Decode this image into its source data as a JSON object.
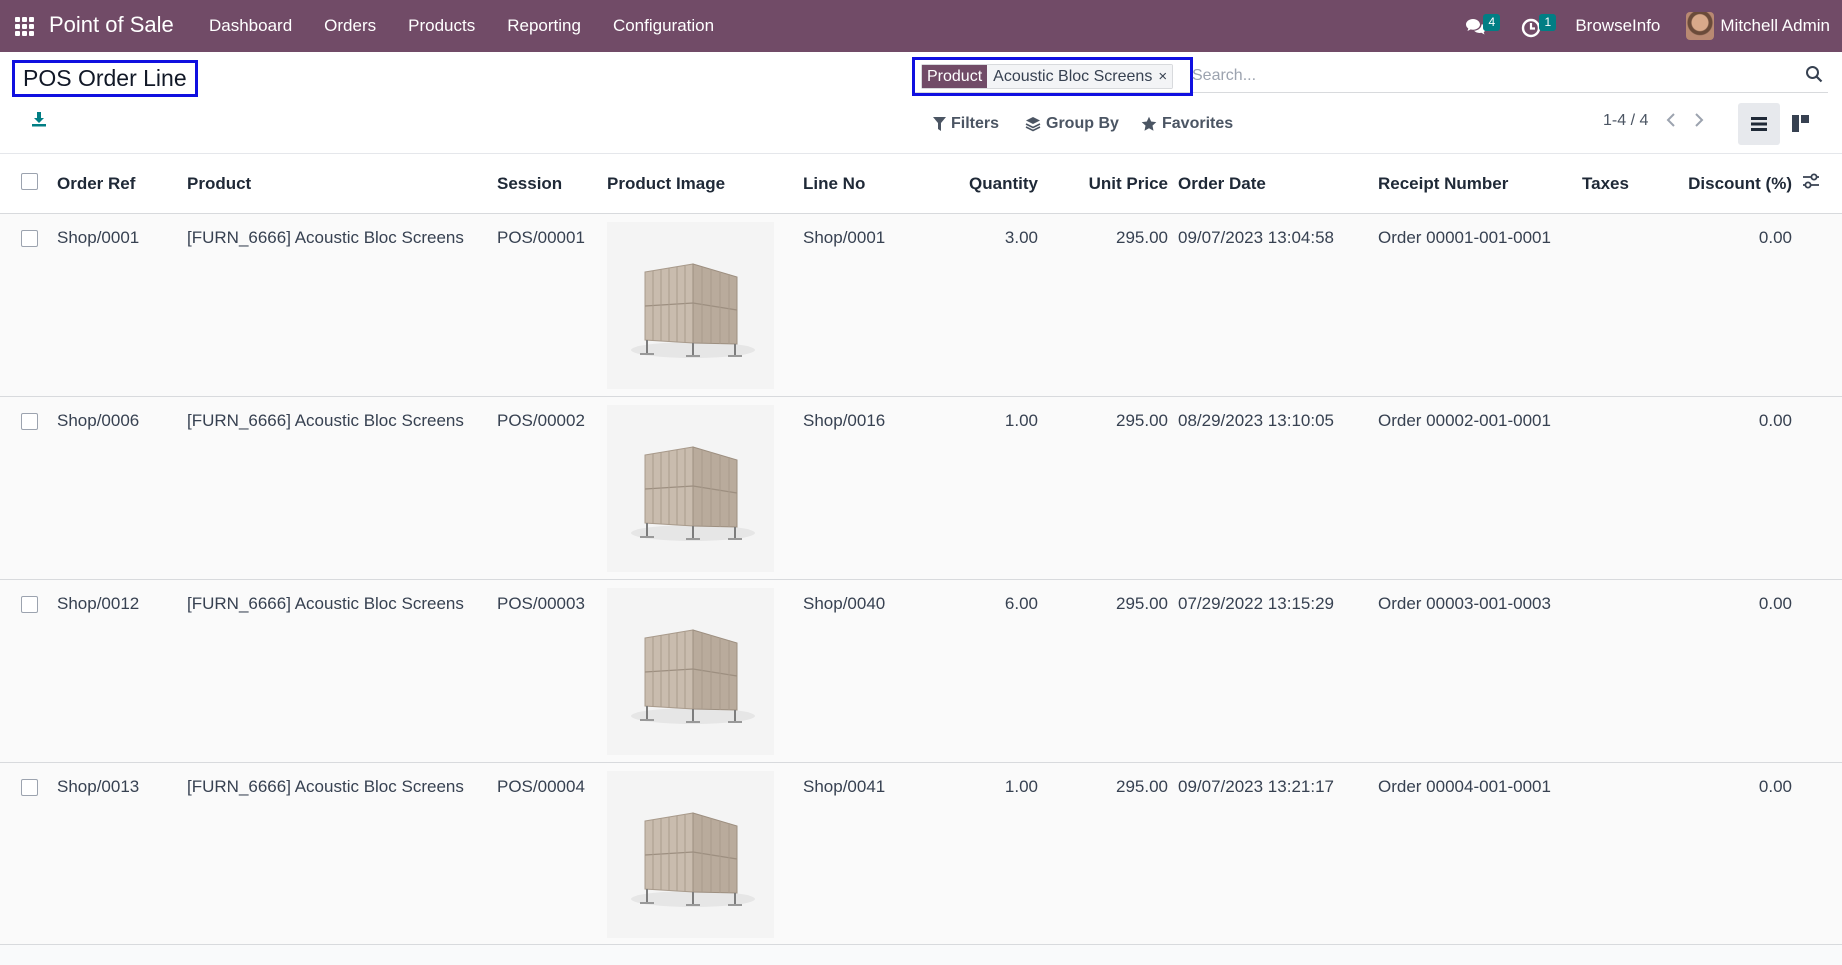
{
  "navbar": {
    "app_name": "Point of Sale",
    "menu": [
      "Dashboard",
      "Orders",
      "Products",
      "Reporting",
      "Configuration"
    ],
    "messages_count": "4",
    "activities_count": "1",
    "company": "BrowseInfo",
    "user": "Mitchell Admin",
    "color": "#714b67"
  },
  "page": {
    "title": "POS Order Line"
  },
  "search": {
    "facet_label": "Product",
    "facet_value": "Acoustic Bloc Screens",
    "facet_remove": "×",
    "placeholder": "Search..."
  },
  "toolbar": {
    "filters": "Filters",
    "group_by": "Group By",
    "favorites": "Favorites",
    "pager": "1-4 / 4"
  },
  "table": {
    "columns": [
      "Order Ref",
      "Product",
      "Session",
      "Product Image",
      "Line No",
      "Quantity",
      "Unit Price",
      "Order Date",
      "Receipt Number",
      "Taxes",
      "Discount (%)"
    ],
    "rows": [
      {
        "order_ref": "Shop/0001",
        "product": "[FURN_6666] Acoustic Bloc Screens",
        "session": "POS/00001",
        "line_no": "Shop/0001",
        "quantity": "3.00",
        "unit_price": "295.00",
        "order_date": "09/07/2023 13:04:58",
        "receipt": "Order 00001-001-0001",
        "taxes": "",
        "discount": "0.00"
      },
      {
        "order_ref": "Shop/0006",
        "product": "[FURN_6666] Acoustic Bloc Screens",
        "session": "POS/00002",
        "line_no": "Shop/0016",
        "quantity": "1.00",
        "unit_price": "295.00",
        "order_date": "08/29/2023 13:10:05",
        "receipt": "Order 00002-001-0001",
        "taxes": "",
        "discount": "0.00"
      },
      {
        "order_ref": "Shop/0012",
        "product": "[FURN_6666] Acoustic Bloc Screens",
        "session": "POS/00003",
        "line_no": "Shop/0040",
        "quantity": "6.00",
        "unit_price": "295.00",
        "order_date": "07/29/2022 13:15:29",
        "receipt": "Order 00003-001-0003",
        "taxes": "",
        "discount": "0.00"
      },
      {
        "order_ref": "Shop/0013",
        "product": "[FURN_6666] Acoustic Bloc Screens",
        "session": "POS/00004",
        "line_no": "Shop/0041",
        "quantity": "1.00",
        "unit_price": "295.00",
        "order_date": "09/07/2023 13:21:17",
        "receipt": "Order 00004-001-0001",
        "taxes": "",
        "discount": "0.00"
      }
    ]
  }
}
